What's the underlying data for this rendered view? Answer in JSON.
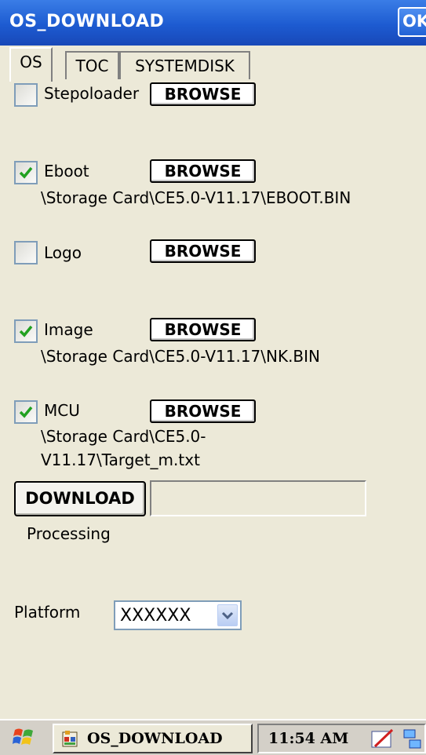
{
  "window": {
    "title": "OS_DOWNLOAD",
    "ok_label": "OK"
  },
  "tabs": [
    {
      "label": "OS",
      "active": true
    },
    {
      "label": "TOC",
      "active": false
    },
    {
      "label": "SYSTEMDISK",
      "active": false
    }
  ],
  "items": [
    {
      "label": "Stepoloader",
      "checked": false,
      "browse_label": "BROWSE",
      "path": ""
    },
    {
      "label": "Eboot",
      "checked": true,
      "browse_label": "BROWSE",
      "path": "\\Storage Card\\CE5.0-V11.17\\EBOOT.BIN"
    },
    {
      "label": "Logo",
      "checked": false,
      "browse_label": "BROWSE",
      "path": ""
    },
    {
      "label": "Image",
      "checked": true,
      "browse_label": "BROWSE",
      "path": "\\Storage Card\\CE5.0-V11.17\\NK.BIN"
    },
    {
      "label": "MCU",
      "checked": true,
      "browse_label": "BROWSE",
      "path_line1": "\\Storage Card\\CE5.0-",
      "path_line2": "V11.17\\Target_m.txt"
    }
  ],
  "download": {
    "label": "DOWNLOAD",
    "progress": 0,
    "status": "Processing"
  },
  "platform": {
    "label": "Platform",
    "value": "XXXXXX"
  },
  "taskbar": {
    "app_label": "OS_DOWNLOAD",
    "time": "11:54 AM"
  },
  "colors": {
    "titlebar": "#1d5bd1",
    "checkmark": "#21a121",
    "background": "#ece9d8"
  }
}
